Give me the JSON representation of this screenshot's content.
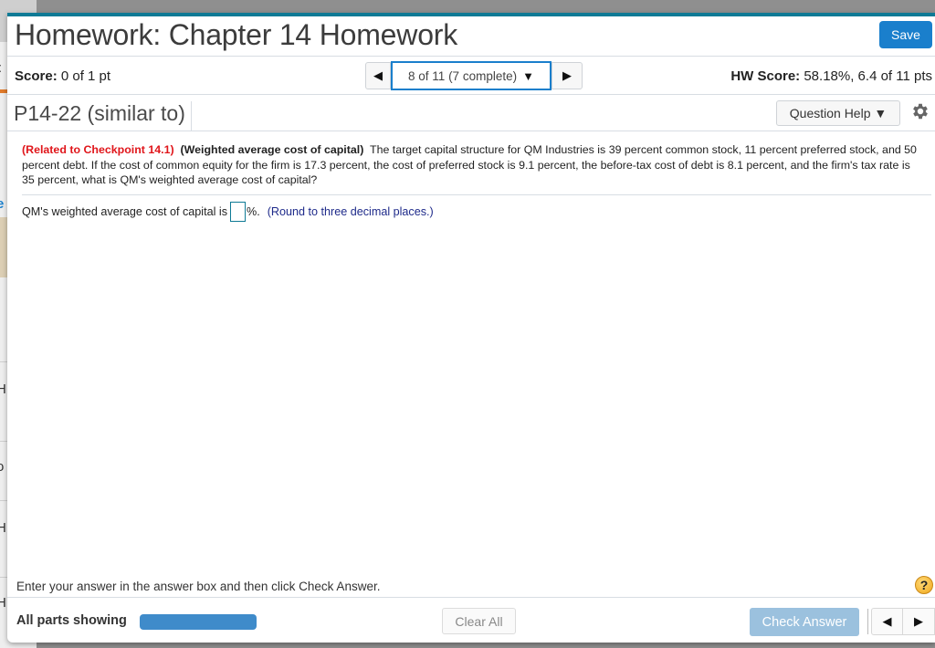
{
  "background_page": {
    "letters": [
      "t",
      "e",
      "H",
      "o",
      "H",
      "H"
    ]
  },
  "header": {
    "title": "Homework: Chapter 14 Homework",
    "save_label": "Save"
  },
  "score_bar": {
    "score_label": "Score:",
    "score_value": "0 of 1 pt",
    "question_nav": {
      "prev_icon": "◀",
      "selected": "8 of 11 (7 complete)",
      "caret": "▼",
      "next_icon": "▶"
    },
    "hw_score_label": "HW Score:",
    "hw_score_value": "58.18%, 6.4 of 11 pts"
  },
  "question_header": {
    "id": "P14-22 (similar to)",
    "help_label": "Question Help ▼"
  },
  "problem": {
    "related": "(Related to Checkpoint 14.1)",
    "topic": "(Weighted average cost of capital)",
    "body": "The target capital structure for QM Industries is 39 percent common stock, 11 percent preferred stock, and 50 percent debt.  If the cost of common equity for the firm is 17.3  percent, the cost of preferred stock is 9.1 percent, the before-tax cost of debt is 8.1 percent, and the firm's tax rate is 35 percent, what is QM's weighted average cost of capital?"
  },
  "answer": {
    "prompt": "QM's weighted average cost of capital is",
    "value": "",
    "suffix": "%.",
    "hint": "(Round to three decimal places.)"
  },
  "instructions": "Enter your answer in the answer box and then click Check Answer.",
  "help_icon": "?",
  "footer": {
    "parts_label": "All parts showing",
    "parts_progress": 1.0,
    "clear_all_label": "Clear All",
    "check_answer_label": "Check Answer",
    "prev_icon": "◀",
    "next_icon": "▶"
  },
  "colors": {
    "accent": "#1a7fcc",
    "top_border": "#0e7a95",
    "related_red": "#e0161b",
    "hint_blue": "#1e2a8a",
    "check_disabled": "#9bc1de"
  }
}
